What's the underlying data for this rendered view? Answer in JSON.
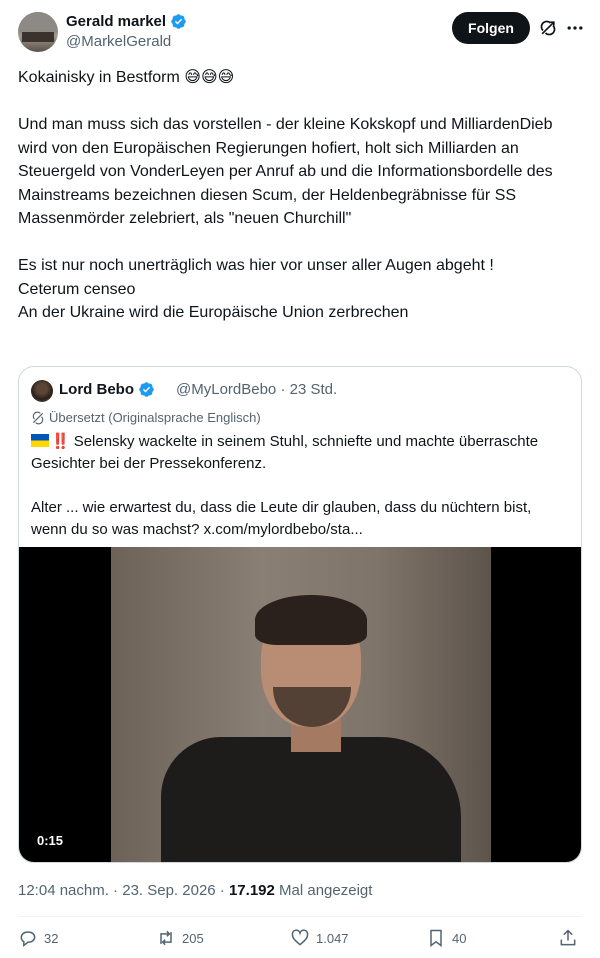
{
  "author": {
    "name": "Gerald markel",
    "handle": "@MarkelGerald",
    "follow_label": "Folgen"
  },
  "post": {
    "title_line": "Kokainisky in Bestform 😅😅😅",
    "para1": "Und man muss sich das vorstellen - der kleine Kokskopf und MilliardenDieb wird von den Europäischen Regierungen hofiert, holt sich Milliarden an Steuergeld von VonderLeyen per Anruf ab und die Informationsbordelle des Mainstreams bezeichnen diesen Scum, der Heldenbegräbnisse für SS Massenmörder zelebriert, als \"neuen Churchill\"",
    "line1": "Es ist nur noch unerträglich was hier vor unser aller Augen abgeht !",
    "line2": "Ceterum censeo",
    "line3": "An der Ukraine wird die Europäische Union zerbrechen"
  },
  "quote": {
    "name": "Lord Bebo",
    "handle_time": "@MyLordBebo · 23 Std.",
    "translated_label": "Übersetzt (Originalsprache Englisch)",
    "bang": "‼️",
    "text1": "Selensky wackelte in seinem Stuhl, schniefte und machte überraschte Gesichter bei der Pressekonferenz.",
    "text2": "Alter ... wie erwartest du, dass die Leute dir glauben, dass du nüchtern bist, wenn du so was machst? x.com/mylordbebo/sta...",
    "video_duration": "0:15"
  },
  "meta": {
    "time_date": "12:04 nachm. · 23. Sep. 2026 · ",
    "views": "17.192",
    "views_label": " Mal angezeigt"
  },
  "actions": {
    "replies": "32",
    "reposts": "205",
    "likes": "1.047",
    "bookmarks": "40"
  },
  "colors": {
    "verified": "#1d9bf0",
    "text_primary": "#0f1419",
    "text_secondary": "#536471",
    "border": "#cfd9de"
  },
  "icons": [
    "verified-badge-icon",
    "grok-icon",
    "more-icon",
    "translate-icon",
    "ukraine-flag-icon",
    "reply-icon",
    "repost-icon",
    "like-icon",
    "bookmark-icon",
    "share-icon"
  ]
}
